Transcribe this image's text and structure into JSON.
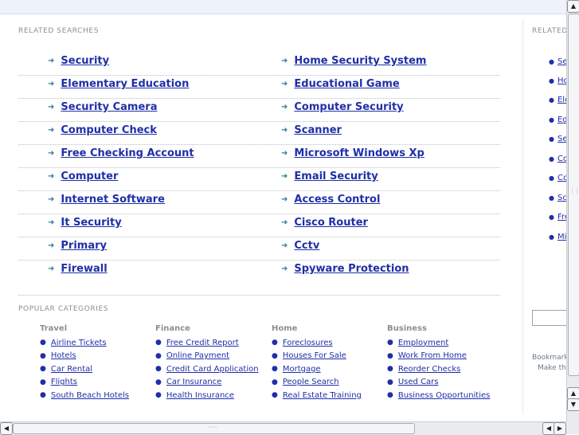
{
  "related": {
    "label": "RELATED SEARCHES",
    "left": [
      "Security",
      "Elementary Education",
      "Security Camera",
      "Computer Check",
      "Free Checking Account",
      "Computer",
      "Internet Software",
      "It Security",
      "Primary",
      "Firewall"
    ],
    "right": [
      "Home Security System",
      "Educational Game",
      "Computer Security",
      "Scanner",
      "Microsoft Windows Xp",
      "Email Security",
      "Access Control",
      "Cisco Router",
      "Cctv",
      "Spyware Protection"
    ]
  },
  "popular": {
    "label": "POPULAR CATEGORIES",
    "categories": [
      {
        "title": "Travel",
        "items": [
          "Airline Tickets",
          "Hotels",
          "Car Rental",
          "Flights",
          "South Beach Hotels"
        ]
      },
      {
        "title": "Finance",
        "items": [
          "Free Credit Report",
          "Online Payment",
          "Credit Card Application",
          "Car Insurance",
          "Health Insurance"
        ]
      },
      {
        "title": "Home",
        "items": [
          "Foreclosures",
          "Houses For Sale",
          "Mortgage",
          "People Search",
          "Real Estate Training"
        ]
      },
      {
        "title": "Business",
        "items": [
          "Employment",
          "Work From Home",
          "Reorder Checks",
          "Used Cars",
          "Business Opportunities"
        ]
      }
    ]
  },
  "sidebar": {
    "label": "RELATED",
    "items": [
      "Se",
      "Ho",
      "Ele",
      "Ed",
      "Se",
      "Co",
      "Co",
      "Sc",
      "Fre",
      "Mi"
    ],
    "bookmark_text": "Bookmark",
    "make_text": "Make thi"
  },
  "scroll": {
    "up_icon": "▲",
    "down_icon": "▼",
    "left_icon": "◀",
    "right_icon": "▶"
  }
}
